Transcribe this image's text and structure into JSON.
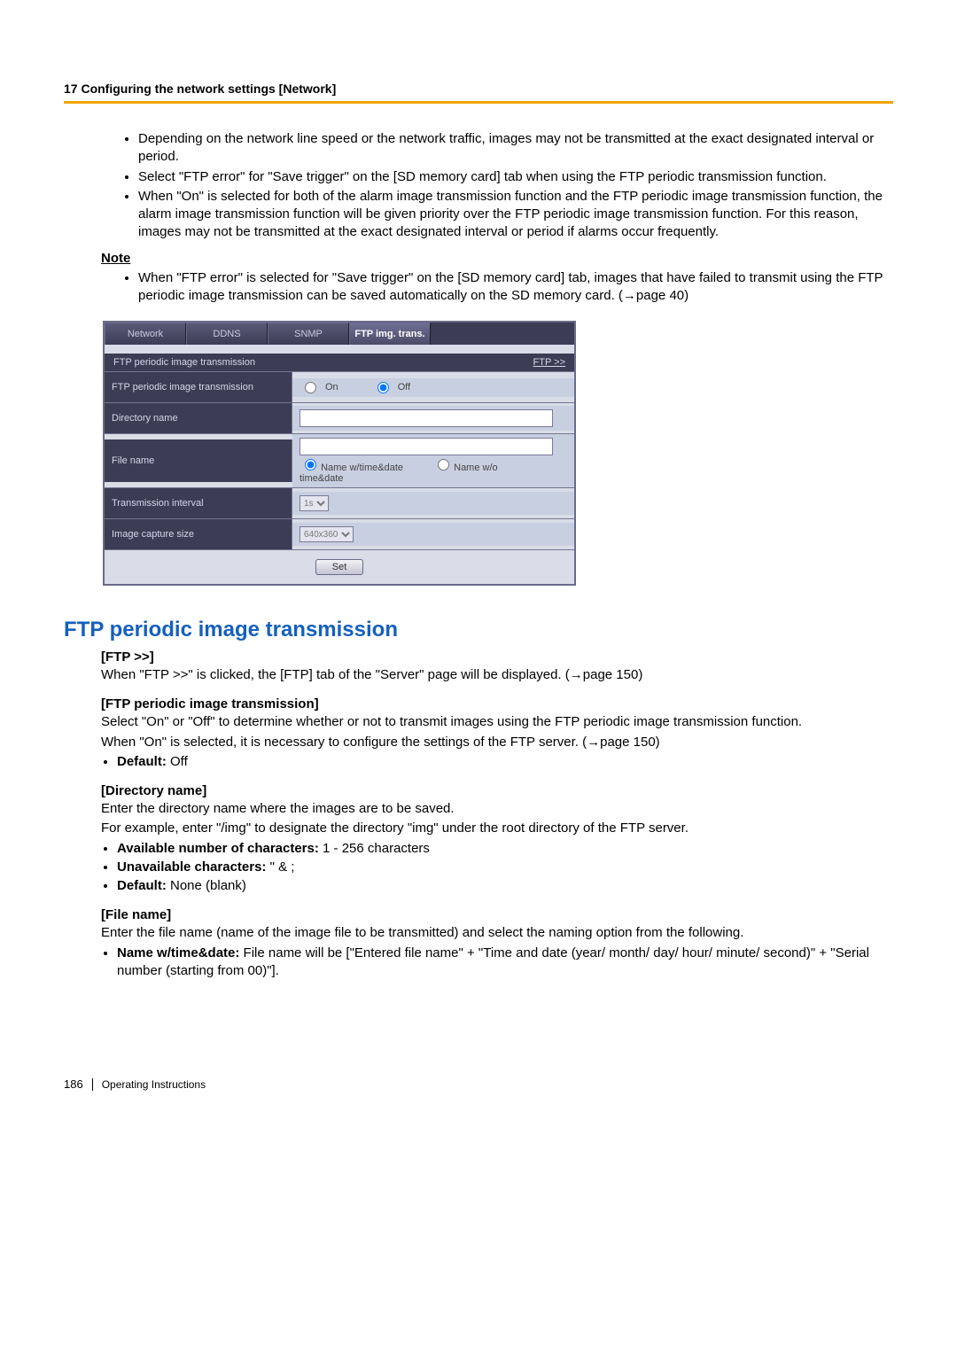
{
  "header": {
    "chapter": "17 Configuring the network settings [Network]"
  },
  "top_bullets": [
    "Depending on the network line speed or the network traffic, images may not be transmitted at the exact designated interval or period.",
    "Select \"FTP error\" for \"Save trigger\" on the [SD memory card] tab when using the FTP periodic transmission function.",
    "When \"On\" is selected for both of the alarm image transmission function and the FTP periodic image transmission function, the alarm image transmission function will be given priority over the FTP periodic image transmission function. For this reason, images may not be transmitted at the exact designated interval or period if alarms occur frequently."
  ],
  "note_label": "Note",
  "note_bullets": [
    "When \"FTP error\" is selected for \"Save trigger\" on the [SD memory card] tab, images that have failed to transmit using the FTP periodic image transmission can be saved automatically on the SD memory card. (→page 40)"
  ],
  "panel": {
    "tabs": [
      "Network",
      "DDNS",
      "SNMP",
      "FTP img. trans."
    ],
    "active_tab_index": 3,
    "section_title": "FTP periodic image transmission",
    "ftp_link": "FTP >>",
    "rows": {
      "transmission_label": "FTP periodic image transmission",
      "on": "On",
      "off": "Off",
      "directory_label": "Directory name",
      "file_label": "File name",
      "name_with": "Name w/time&date",
      "name_without": "Name w/o time&date",
      "interval_label": "Transmission interval",
      "interval_value": "1s",
      "capture_label": "Image capture size",
      "capture_value": "640x360"
    },
    "set": "Set"
  },
  "section_title": "FTP periodic image transmission",
  "ftp": {
    "heading": "[FTP >>]",
    "text": "When \"FTP >>\" is clicked, the [FTP] tab of the \"Server\" page will be displayed. (→page 150)"
  },
  "ftp_periodic": {
    "heading": "[FTP periodic image transmission]",
    "p1": "Select \"On\" or \"Off\" to determine whether or not to transmit images using the FTP periodic image transmission function.",
    "p2": "When \"On\" is selected, it is necessary to configure the settings of the FTP server. (→page 150)",
    "default_bold": "Default:",
    "default_val": " Off"
  },
  "directory": {
    "heading": "[Directory name]",
    "p1": "Enter the directory name where the images are to be saved.",
    "p2": "For example, enter \"/img\" to designate the directory \"img\" under the root directory of the FTP server.",
    "b1_bold": "Available number of characters:",
    "b1_rest": " 1 - 256 characters",
    "b2_bold": "Unavailable characters:",
    "b2_rest": " \" & ;",
    "b3_bold": "Default:",
    "b3_rest": " None (blank)"
  },
  "filename": {
    "heading": "[File name]",
    "p1": "Enter the file name (name of the image file to be transmitted) and select the naming option from the following.",
    "b1_bold": "Name w/time&date:",
    "b1_rest": " File name will be [\"Entered file name\" + \"Time and date (year/ month/ day/ hour/ minute/ second)\" + \"Serial number (starting from 00)\"]."
  },
  "footer": {
    "page_number": "186",
    "doc_title": "Operating Instructions"
  }
}
